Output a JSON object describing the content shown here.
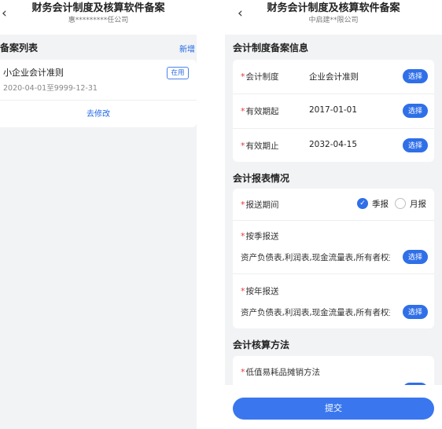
{
  "left": {
    "nav": {
      "back_icon": "‹",
      "title": "财务会计制度及核算软件备案",
      "subtitle": "惠*********任公司"
    },
    "list_title": "备案列表",
    "add_label": "新增",
    "record": {
      "name": "小企业会计准则",
      "date_range": "2020-04-01至9999-12-31",
      "status": "在用",
      "edit_label": "去修改"
    }
  },
  "right": {
    "nav": {
      "back_icon": "‹",
      "title": "财务会计制度及核算软件备案",
      "subtitle": "中启建**限公司"
    },
    "sections": {
      "system_info": {
        "title": "会计制度备案信息",
        "rows": [
          {
            "label": "会计制度",
            "value": "企业会计准则",
            "button": "选择"
          },
          {
            "label": "有效期起",
            "value": "2017-01-01",
            "button": "选择"
          },
          {
            "label": "有效期止",
            "value": "2032-04-15",
            "button": "选择"
          }
        ]
      },
      "report": {
        "title": "会计报表情况",
        "period_label": "报送期间",
        "period_options": [
          {
            "label": "季报",
            "checked": true
          },
          {
            "label": "月报",
            "checked": false
          }
        ],
        "quarterly": {
          "label": "按季报送",
          "value": "资产负债表,利润表,现金流量表,所有者权益变动表",
          "button": "选择"
        },
        "yearly": {
          "label": "按年报送",
          "value": "资产负债表,利润表,现金流量表,所有者权益变动表",
          "button": "选择"
        }
      },
      "method": {
        "title": "会计核算方法",
        "row_label": "低值易耗品摊销方法"
      }
    },
    "required_mark": "*",
    "check_icon": "✓",
    "submit_label": "提交",
    "accent_color": "#2f6fe8"
  }
}
